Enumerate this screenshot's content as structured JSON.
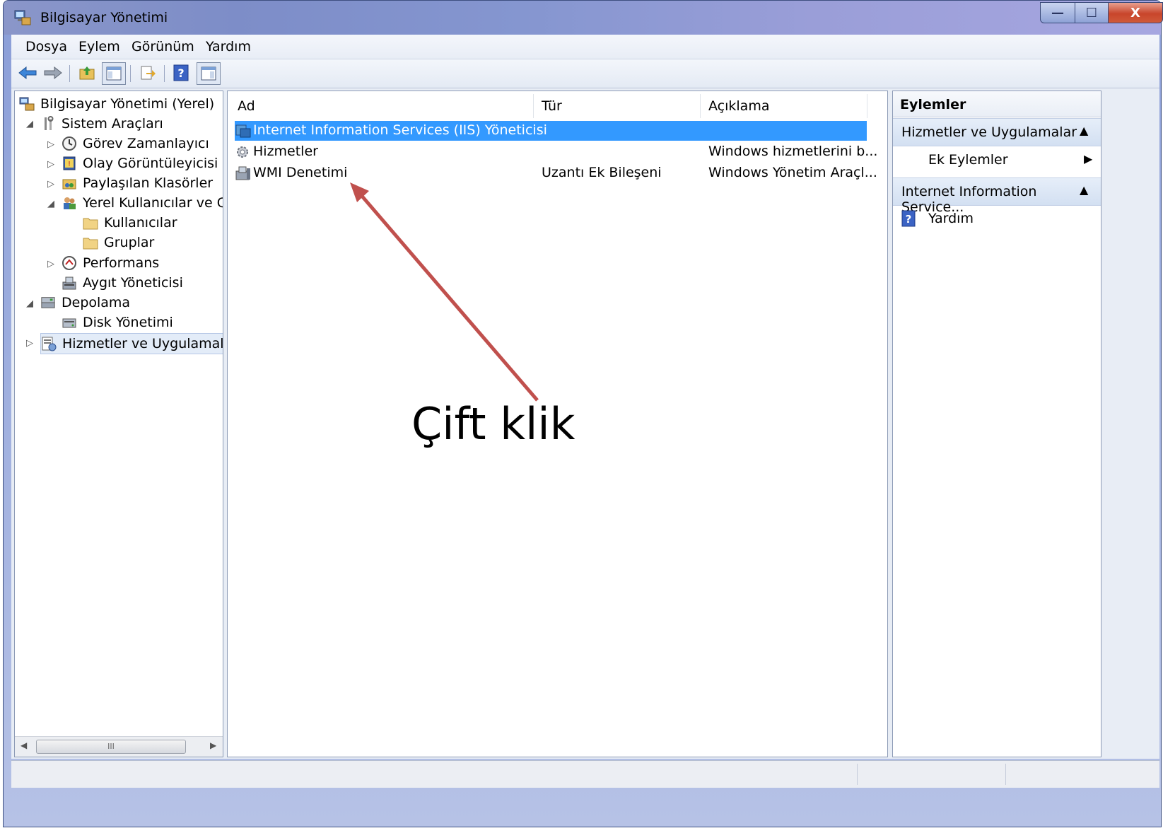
{
  "window": {
    "title": "Bilgisayar Yönetimi",
    "controls": {
      "minimize": "—",
      "maximize": "☐",
      "close": "X"
    }
  },
  "menu": [
    "Dosya",
    "Eylem",
    "Görünüm",
    "Yardım"
  ],
  "toolbar": [
    "back-arrow-icon",
    "forward-arrow-icon",
    "up-folder-icon",
    "show-hide-tree-icon",
    "export-list-icon",
    "help-icon",
    "show-hide-action-pane-icon"
  ],
  "tree": {
    "root": "Bilgisayar Yönetimi (Yerel)",
    "items": [
      "Sistem Araçları",
      "Görev Zamanlayıcı",
      "Olay Görüntüleyicisi",
      "Paylaşılan Klasörler",
      "Yerel Kullanıcılar ve Gru",
      "Kullanıcılar",
      "Gruplar",
      "Performans",
      "Aygıt Yöneticisi",
      "Depolama",
      "Disk Yönetimi",
      "Hizmetler ve Uygulamalar"
    ],
    "scroll_glyph": "III"
  },
  "list": {
    "columns": [
      "Ad",
      "Tür",
      "Açıklama"
    ],
    "rows": [
      {
        "name": "Internet Information Services (IIS) Yöneticisi",
        "type": "",
        "desc": ""
      },
      {
        "name": "Hizmetler",
        "type": "",
        "desc": "Windows hizmetlerini b..."
      },
      {
        "name": "WMI Denetimi",
        "type": "Uzantı Ek Bileşeni",
        "desc": "Windows Yönetim Araçl..."
      }
    ]
  },
  "actions": {
    "title": "Eylemler",
    "section1": "Hizmetler ve Uygulamalar",
    "section1_item": "Ek Eylemler",
    "section2": "Internet Information Service...",
    "section2_item": "Yardım"
  },
  "annotation": {
    "text": "Çift klik",
    "color": "#c0504d"
  }
}
